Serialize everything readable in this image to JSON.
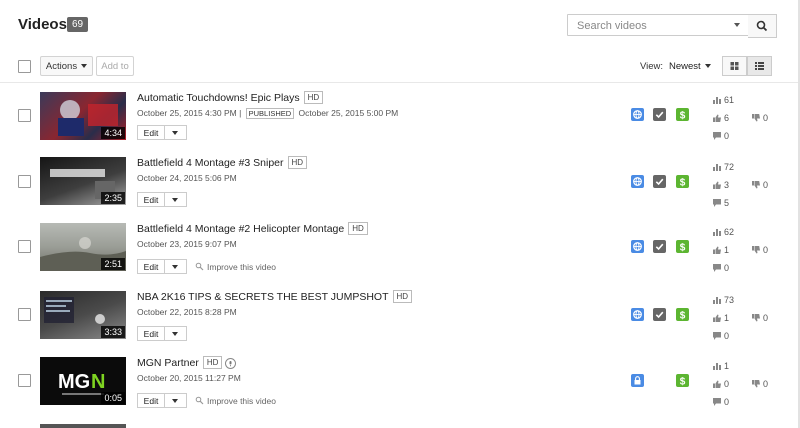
{
  "header": {
    "title": "Videos",
    "count": "69"
  },
  "search": {
    "placeholder": "Search videos"
  },
  "toolbar": {
    "actions_label": "Actions",
    "add_to_label": "Add to",
    "view_label": "View:",
    "sort_label": "Newest"
  },
  "colors": {
    "privacy_public": "#4a8be4",
    "privacy_private": "#4a8be4",
    "check": "#666666",
    "monetized": "#5cb531"
  },
  "videos": [
    {
      "title": "Automatic Touchdowns! Epic Plays",
      "badge": "HD",
      "date": "October 25, 2015 4:30 PM",
      "status": "PUBLISHED",
      "published_date": "October 25, 2015 5:00 PM",
      "duration": "4:34",
      "edit_label": "Edit",
      "improve": "",
      "views": "61",
      "likes": "6",
      "dislikes": "0",
      "comments": "0",
      "privacy_icon": "globe-icon",
      "has_check": true,
      "has_money": true,
      "mic": false
    },
    {
      "title": "Battlefield 4 Montage #3 Sniper",
      "badge": "HD",
      "date": "October 24, 2015 5:06 PM",
      "status": "",
      "published_date": "",
      "duration": "2:35",
      "edit_label": "Edit",
      "improve": "",
      "views": "72",
      "likes": "3",
      "dislikes": "0",
      "comments": "5",
      "privacy_icon": "globe-icon",
      "has_check": true,
      "has_money": true,
      "mic": false
    },
    {
      "title": "Battlefield 4 Montage #2 Helicopter Montage",
      "badge": "HD",
      "date": "October 23, 2015 9:07 PM",
      "status": "",
      "published_date": "",
      "duration": "2:51",
      "edit_label": "Edit",
      "improve": "Improve this video",
      "views": "62",
      "likes": "1",
      "dislikes": "0",
      "comments": "0",
      "privacy_icon": "globe-icon",
      "has_check": true,
      "has_money": true,
      "mic": false
    },
    {
      "title": "NBA 2K16 TIPS & SECRETS THE BEST JUMPSHOT",
      "badge": "HD",
      "date": "October 22, 2015 8:28 PM",
      "status": "",
      "published_date": "",
      "duration": "3:33",
      "edit_label": "Edit",
      "improve": "",
      "views": "73",
      "likes": "1",
      "dislikes": "0",
      "comments": "0",
      "privacy_icon": "globe-icon",
      "has_check": true,
      "has_money": true,
      "mic": false
    },
    {
      "title": "MGN Partner",
      "badge": "HD",
      "date": "October 20, 2015 11:27 PM",
      "status": "",
      "published_date": "",
      "duration": "0:05",
      "edit_label": "Edit",
      "improve": "Improve this video",
      "views": "1",
      "likes": "0",
      "dislikes": "0",
      "comments": "0",
      "privacy_icon": "lock-icon",
      "has_check": false,
      "has_money": true,
      "mic": true
    }
  ]
}
